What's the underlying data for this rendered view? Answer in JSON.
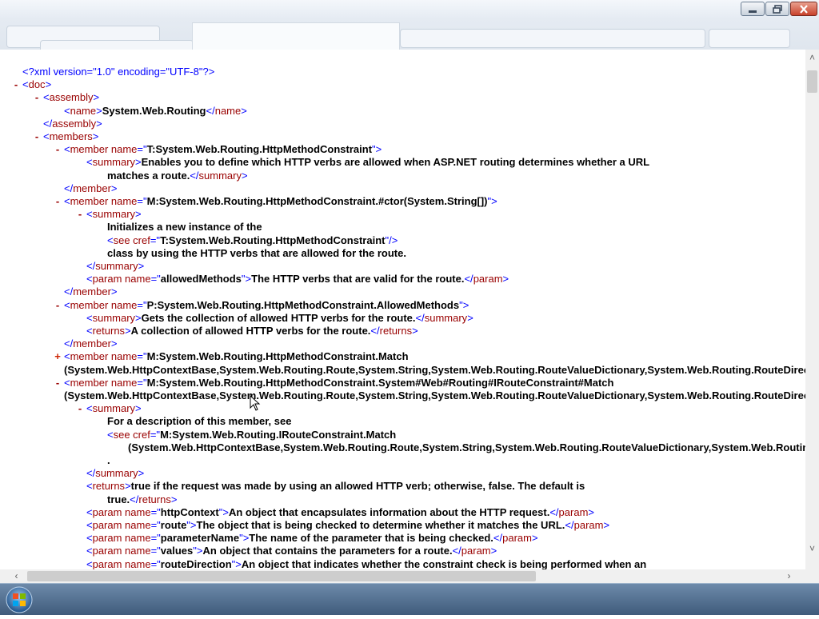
{
  "window": {
    "minimize_icon": "minimize-icon",
    "maximize_icon": "restore-icon",
    "close_icon": "close-icon"
  },
  "xml": {
    "lines": [
      {
        "tog": "",
        "segs": [
          [
            "pi",
            "<?xml version=\"1.0\" encoding=\"UTF-8\"?>"
          ]
        ]
      },
      {
        "tog": "-",
        "segs": [
          [
            "pun",
            "<"
          ],
          [
            "tag",
            "doc"
          ],
          [
            "pun",
            ">"
          ]
        ]
      },
      {
        "tog": "-",
        "segs": [
          [
            "pun",
            "<"
          ],
          [
            "tag",
            "assembly"
          ],
          [
            "pun",
            ">"
          ]
        ]
      },
      {
        "tog": "",
        "segs": [
          [
            "pun",
            "<"
          ],
          [
            "tag",
            "name"
          ],
          [
            "pun",
            ">"
          ],
          [
            "txt",
            "System.Web.Routing"
          ],
          [
            "pun",
            "</"
          ],
          [
            "tag",
            "name"
          ],
          [
            "pun",
            ">"
          ]
        ]
      },
      {
        "tog": "",
        "segs": [
          [
            "pun",
            "</"
          ],
          [
            "tag",
            "assembly"
          ],
          [
            "pun",
            ">"
          ]
        ]
      },
      {
        "tog": "-",
        "segs": [
          [
            "pun",
            "<"
          ],
          [
            "tag",
            "members"
          ],
          [
            "pun",
            ">"
          ]
        ]
      },
      {
        "tog": "-",
        "segs": [
          [
            "pun",
            "<"
          ],
          [
            "tag",
            "member name"
          ],
          [
            "pun",
            "=\""
          ],
          [
            "val",
            "T:System.Web.Routing.HttpMethodConstraint"
          ],
          [
            "pun",
            "\">"
          ]
        ]
      },
      {
        "tog": "",
        "segs": [
          [
            "pun",
            "<"
          ],
          [
            "tag",
            "summary"
          ],
          [
            "pun",
            ">"
          ],
          [
            "txt",
            "Enables you to define which HTTP verbs are allowed when ASP.NET routing determines whether a URL"
          ]
        ]
      },
      {
        "tog": "",
        "segs": [
          [
            "txt",
            "matches a route."
          ],
          [
            "pun",
            "</"
          ],
          [
            "tag",
            "summary"
          ],
          [
            "pun",
            ">"
          ]
        ]
      },
      {
        "tog": "",
        "segs": [
          [
            "pun",
            "</"
          ],
          [
            "tag",
            "member"
          ],
          [
            "pun",
            ">"
          ]
        ]
      },
      {
        "tog": "-",
        "segs": [
          [
            "pun",
            "<"
          ],
          [
            "tag",
            "member name"
          ],
          [
            "pun",
            "=\""
          ],
          [
            "val",
            "M:System.Web.Routing.HttpMethodConstraint.#ctor(System.String[])"
          ],
          [
            "pun",
            "\">"
          ]
        ]
      },
      {
        "tog": "-",
        "segs": [
          [
            "pun",
            "<"
          ],
          [
            "tag",
            "summary"
          ],
          [
            "pun",
            ">"
          ]
        ]
      },
      {
        "tog": "",
        "segs": [
          [
            "txt",
            "Initializes a new instance of the"
          ]
        ]
      },
      {
        "tog": "",
        "segs": [
          [
            "pun",
            "<"
          ],
          [
            "tag",
            "see cref"
          ],
          [
            "pun",
            "=\""
          ],
          [
            "val",
            "T:System.Web.Routing.HttpMethodConstraint"
          ],
          [
            "pun",
            "\"/>"
          ]
        ]
      },
      {
        "tog": "",
        "segs": [
          [
            "txt",
            "class by using the HTTP verbs that are allowed for the route."
          ]
        ]
      },
      {
        "tog": "",
        "segs": [
          [
            "pun",
            "</"
          ],
          [
            "tag",
            "summary"
          ],
          [
            "pun",
            ">"
          ]
        ]
      },
      {
        "tog": "",
        "segs": [
          [
            "pun",
            "<"
          ],
          [
            "tag",
            "param name"
          ],
          [
            "pun",
            "=\""
          ],
          [
            "val",
            "allowedMethods"
          ],
          [
            "pun",
            "\">"
          ],
          [
            "txt",
            "The HTTP verbs that are valid for the route."
          ],
          [
            "pun",
            "</"
          ],
          [
            "tag",
            "param"
          ],
          [
            "pun",
            ">"
          ]
        ]
      },
      {
        "tog": "",
        "segs": [
          [
            "pun",
            "</"
          ],
          [
            "tag",
            "member"
          ],
          [
            "pun",
            ">"
          ]
        ]
      },
      {
        "tog": "-",
        "segs": [
          [
            "pun",
            "<"
          ],
          [
            "tag",
            "member name"
          ],
          [
            "pun",
            "=\""
          ],
          [
            "val",
            "P:System.Web.Routing.HttpMethodConstraint.AllowedMethods"
          ],
          [
            "pun",
            "\">"
          ]
        ]
      },
      {
        "tog": "",
        "segs": [
          [
            "pun",
            "<"
          ],
          [
            "tag",
            "summary"
          ],
          [
            "pun",
            ">"
          ],
          [
            "txt",
            "Gets the collection of allowed HTTP verbs for the route."
          ],
          [
            "pun",
            "</"
          ],
          [
            "tag",
            "summary"
          ],
          [
            "pun",
            ">"
          ]
        ]
      },
      {
        "tog": "",
        "segs": [
          [
            "pun",
            "<"
          ],
          [
            "tag",
            "returns"
          ],
          [
            "pun",
            ">"
          ],
          [
            "txt",
            "A collection of allowed HTTP verbs for the route."
          ],
          [
            "pun",
            "</"
          ],
          [
            "tag",
            "returns"
          ],
          [
            "pun",
            ">"
          ]
        ]
      },
      {
        "tog": "",
        "segs": [
          [
            "pun",
            "</"
          ],
          [
            "tag",
            "member"
          ],
          [
            "pun",
            ">"
          ]
        ]
      },
      {
        "tog": "+",
        "segs": [
          [
            "pun",
            "<"
          ],
          [
            "tag",
            "member name"
          ],
          [
            "pun",
            "=\""
          ],
          [
            "val",
            "M:System.Web.Routing.HttpMethodConstraint.Match"
          ]
        ]
      },
      {
        "tog": "",
        "segs": [
          [
            "val",
            "(System.Web.HttpContextBase,System.Web.Routing.Route,System.String,System.Web.Routing.RouteValueDictionary,System.Web.Routing.RouteDirection)"
          ],
          [
            "pun",
            "\">"
          ]
        ]
      },
      {
        "tog": "-",
        "segs": [
          [
            "pun",
            "<"
          ],
          [
            "tag",
            "member name"
          ],
          [
            "pun",
            "=\""
          ],
          [
            "val",
            "M:System.Web.Routing.HttpMethodConstraint.System#Web#Routing#IRouteConstraint#Match"
          ]
        ]
      },
      {
        "tog": "",
        "segs": [
          [
            "val",
            "(System.Web.HttpContextBase,System.Web.Routing.Route,System.String,System.Web.Routing.RouteValueDictionary,System.Web.Routing.RouteDirection)"
          ],
          [
            "pun",
            "\">"
          ]
        ]
      },
      {
        "tog": "-",
        "segs": [
          [
            "pun",
            "<"
          ],
          [
            "tag",
            "summary"
          ],
          [
            "pun",
            ">"
          ]
        ]
      },
      {
        "tog": "",
        "segs": [
          [
            "txt",
            "For a description of this member, see"
          ]
        ]
      },
      {
        "tog": "",
        "segs": [
          [
            "pun",
            "<"
          ],
          [
            "tag",
            "see cref"
          ],
          [
            "pun",
            "=\""
          ],
          [
            "val",
            "M:System.Web.Routing.IRouteConstraint.Match"
          ]
        ]
      },
      {
        "tog": "",
        "segs": [
          [
            "val",
            "(System.Web.HttpContextBase,System.Web.Routing.Route,System.String,System.Web.Routing.RouteValueDictionary,System.Web.Routing.RouteDirection)"
          ],
          [
            "pun",
            "\"/>"
          ]
        ]
      },
      {
        "tog": "",
        "segs": [
          [
            "txt",
            "."
          ]
        ]
      },
      {
        "tog": "",
        "segs": [
          [
            "pun",
            "</"
          ],
          [
            "tag",
            "summary"
          ],
          [
            "pun",
            ">"
          ]
        ]
      },
      {
        "tog": "",
        "segs": [
          [
            "pun",
            "<"
          ],
          [
            "tag",
            "returns"
          ],
          [
            "pun",
            ">"
          ],
          [
            "txt",
            "true if the request was made by using an allowed HTTP verb; otherwise, false. The default is"
          ]
        ]
      },
      {
        "tog": "",
        "segs": [
          [
            "txt",
            "true."
          ],
          [
            "pun",
            "</"
          ],
          [
            "tag",
            "returns"
          ],
          [
            "pun",
            ">"
          ]
        ]
      },
      {
        "tog": "",
        "segs": [
          [
            "pun",
            "<"
          ],
          [
            "tag",
            "param name"
          ],
          [
            "pun",
            "=\""
          ],
          [
            "val",
            "httpContext"
          ],
          [
            "pun",
            "\">"
          ],
          [
            "txt",
            "An object that encapsulates information about the HTTP request."
          ],
          [
            "pun",
            "</"
          ],
          [
            "tag",
            "param"
          ],
          [
            "pun",
            ">"
          ]
        ]
      },
      {
        "tog": "",
        "segs": [
          [
            "pun",
            "<"
          ],
          [
            "tag",
            "param name"
          ],
          [
            "pun",
            "=\""
          ],
          [
            "val",
            "route"
          ],
          [
            "pun",
            "\">"
          ],
          [
            "txt",
            "The object that is being checked to determine whether it matches the URL."
          ],
          [
            "pun",
            "</"
          ],
          [
            "tag",
            "param"
          ],
          [
            "pun",
            ">"
          ]
        ]
      },
      {
        "tog": "",
        "segs": [
          [
            "pun",
            "<"
          ],
          [
            "tag",
            "param name"
          ],
          [
            "pun",
            "=\""
          ],
          [
            "val",
            "parameterName"
          ],
          [
            "pun",
            "\">"
          ],
          [
            "txt",
            "The name of the parameter that is being checked."
          ],
          [
            "pun",
            "</"
          ],
          [
            "tag",
            "param"
          ],
          [
            "pun",
            ">"
          ]
        ]
      },
      {
        "tog": "",
        "segs": [
          [
            "pun",
            "<"
          ],
          [
            "tag",
            "param name"
          ],
          [
            "pun",
            "=\""
          ],
          [
            "val",
            "values"
          ],
          [
            "pun",
            "\">"
          ],
          [
            "txt",
            "An object that contains the parameters for a route."
          ],
          [
            "pun",
            "</"
          ],
          [
            "tag",
            "param"
          ],
          [
            "pun",
            ">"
          ]
        ]
      },
      {
        "tog": "",
        "segs": [
          [
            "pun",
            "<"
          ],
          [
            "tag",
            "param name"
          ],
          [
            "pun",
            "=\""
          ],
          [
            "val",
            "routeDirection"
          ],
          [
            "pun",
            "\">"
          ],
          [
            "txt",
            "An object that indicates whether the constraint check is being performed when an"
          ]
        ]
      }
    ]
  },
  "scrollbars": {
    "vertical_position": 0.02,
    "horizontal_position": 0.0
  }
}
